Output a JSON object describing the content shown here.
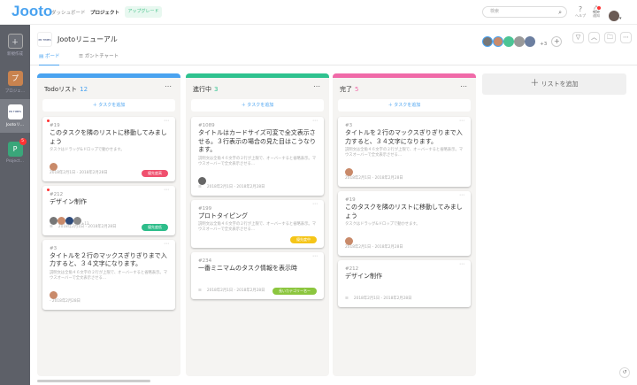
{
  "topbar": {
    "logo": "Jooto",
    "nav": [
      "ダッシュボード",
      "プロジェクト"
    ],
    "upgrade": "アップグレード",
    "search_placeholder": "検索",
    "help": "ヘルプ",
    "notify": "通知"
  },
  "sidebar": {
    "items": [
      {
        "label": "新規作成",
        "icon": "＋",
        "color": "#6c6f77"
      },
      {
        "label": "プロジェ…",
        "icon": "プ",
        "color": "#c9834f"
      },
      {
        "label": "Jootoリ…",
        "icon": "PR TIMES",
        "color": "#ffffff"
      },
      {
        "label": "Project…",
        "icon": "P",
        "color": "#3aa67a",
        "badge": "5"
      }
    ]
  },
  "project": {
    "logo": "PR TIMES",
    "title": "Jootoリニューアル",
    "tabs": [
      "ボード",
      "ガントチャート"
    ],
    "more_members": "+3"
  },
  "board": {
    "add_task": "＋ タスクを追加",
    "add_list": "リストを追加",
    "columns": [
      {
        "title": "Todoリスト",
        "count": "12",
        "color": "#4aa3f0",
        "cards": [
          {
            "dot": true,
            "num": "#19",
            "title": "このタスクを隣のリストに移動してみましょう",
            "desc": "タスクはドラッグ&ドロップで動かせます。",
            "avatars": [
              "#c98a6a"
            ],
            "date": "2018年2月1日 - 2018年2月28日",
            "badge": "優先度高",
            "badge_color": "#f0506e"
          },
          {
            "dot": true,
            "num": "#212",
            "title": "デザイン制作",
            "desc": "",
            "avatars": [
              "#777",
              "#c98a6a",
              "#2d4a7a",
              "#888"
            ],
            "more": "+13",
            "list": true,
            "date": "2018年2月1日 - 2018年2月28日",
            "badge": "優先度低",
            "badge_color": "#2dbd8a"
          },
          {
            "num": "#3",
            "title": "タイトルを２行のマックスぎりぎりまで入力すると、３４文字になります。",
            "desc": "説明文は全角４６文字の２行が上限で、オーバーすると省略表示。マウスオーバーで全文表示させる…",
            "avatars": [
              "#c98a6a"
            ],
            "date": "- 2018年2月28日"
          }
        ]
      },
      {
        "title": "進行中",
        "count": "3",
        "color": "#2fc28f",
        "cards": [
          {
            "num": "#1089",
            "title": "タイトルはカードサイズ可変で全文表示させる。３行表示の場合の見た目はこうなります。",
            "desc": "説明文は全角４６文字の２行が上限で、オーバーすると省略表示。マウスオーバーで全文表示させる…",
            "avatars": [
              "#666"
            ],
            "list": true,
            "date": "2018年2月1日 - 2018年2月28日"
          },
          {
            "num": "#199",
            "title": "プロトタイピング",
            "desc": "説明文は全角４６文字の２行が上限で、オーバーすると省略表示。マウスオーバーで全文表示させる…",
            "date": "",
            "badge": "優先度中",
            "badge_color": "#f5c518"
          },
          {
            "num": "#234",
            "title": "一番ミニマムのタスク情報を表示時",
            "desc": "",
            "list": true,
            "date": "2018年2月1日 - 2018年2月28日",
            "badge": "長いカテゴリー名ー",
            "badge_color": "#8cc63f"
          }
        ]
      },
      {
        "title": "完了",
        "count": "5",
        "color": "#f06aa8",
        "cards": [
          {
            "num": "#3",
            "title": "タイトルを２行のマックスぎりぎりまで入力すると、３４文字になります。",
            "desc": "説明文は全角４６文字の２行が上限で、オーバーすると省略表示。マウスオーバーで全文表示させる…",
            "avatars": [
              "#c98a6a"
            ],
            "date": "2018年2月1日 - 2018年2月28日"
          },
          {
            "num": "#19",
            "title": "このタスクを隣のリストに移動してみましょう",
            "desc": "タスクはドラッグ&ドロップで動かせます。",
            "avatars": [
              "#c98a6a"
            ],
            "date": "2018年2月1日 - 2018年2月28日"
          },
          {
            "num": "#212",
            "title": "デザイン制作",
            "desc": "",
            "list": true,
            "date": "2018年2月1日 - 2018年2月28日"
          }
        ]
      }
    ]
  }
}
